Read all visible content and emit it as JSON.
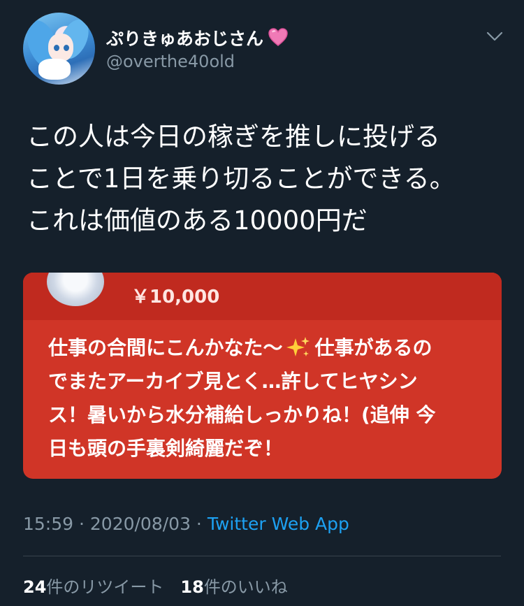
{
  "profile": {
    "display_name": "ぷりきゅあおじさん",
    "handle": "@overthe40old",
    "name_emoji": "pink-heart-icon"
  },
  "tweet": {
    "lines": [
      "この人は今日の稼ぎを推しに投げる",
      "ことで1日を乗り切ることができる。",
      "これは価値のある10000円だ"
    ]
  },
  "superchat": {
    "amount": "￥10,000",
    "message_line1_a": "仕事の合間にこんかなた～",
    "message_line1_b": "仕事があるの",
    "message_lines": [
      "でまたアーカイブ見とく…許してヒヤシン",
      "ス！暑いから水分補給しっかりね！(追伸 今",
      "日も頭の手裏剣綺麗だぞ！"
    ],
    "colors": {
      "body": "#d03527",
      "header": "#c02a1f"
    }
  },
  "meta": {
    "time": "15:59",
    "separator": " · ",
    "date": "2020/08/03",
    "source": "Twitter Web App"
  },
  "stats": {
    "retweets_count": "24",
    "retweets_label": "件のリツイート",
    "likes_count": "18",
    "likes_label": "件のいいね"
  },
  "colors": {
    "background": "#15202b",
    "secondary_text": "#8899a6",
    "link": "#1da1f2"
  }
}
